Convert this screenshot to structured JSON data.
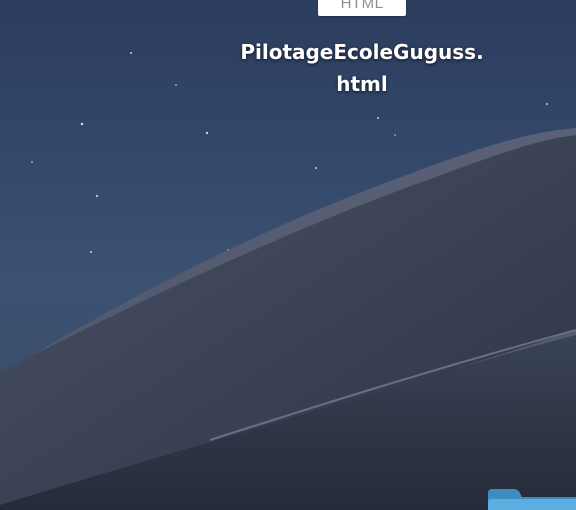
{
  "desktop": {
    "wallpaper": "dusk-dune-icon",
    "items": [
      {
        "type_label": "HTML",
        "filename": "PilotageEcoleGuguss.html",
        "icon": "html-file-icon"
      },
      {
        "icon": "folder-icon",
        "color": "#4a9fd0"
      }
    ]
  }
}
